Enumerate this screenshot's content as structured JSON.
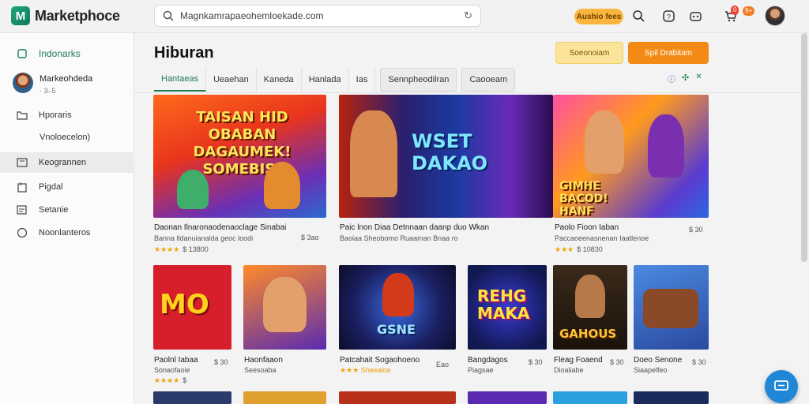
{
  "header": {
    "logo_text": "Marketphoce",
    "search_value": "Magnkamrapaeohemloekade.com",
    "promo_pill": "Aushio fees",
    "cart_badge": "0",
    "notif_badge": "9+"
  },
  "sidebar": {
    "items": [
      {
        "label": "Indonarks",
        "icon": "bookmark-icon"
      },
      {
        "label": "Hporaris",
        "icon": "folder-icon"
      },
      {
        "label": "Vnoloecelon)",
        "icon": ""
      },
      {
        "label": "Keogrannen",
        "icon": "image-icon"
      },
      {
        "label": "Pigdal",
        "icon": "tag-icon"
      },
      {
        "label": "Setanie",
        "icon": "list-icon"
      },
      {
        "label": "Noonlanteros",
        "icon": "help-icon"
      }
    ],
    "profile": {
      "name": "Markeohdeda",
      "sub": "· 3 ̶ 5"
    }
  },
  "main": {
    "title": "Hiburan",
    "btn_secondary": "Soeonoiam",
    "btn_primary": "Spil Drabitam",
    "tabs": [
      {
        "label": "Hantaeas",
        "active": true
      },
      {
        "label": "Ueaehan"
      },
      {
        "label": "Kaneda"
      },
      {
        "label": "Hanlada"
      },
      {
        "label": "Ias"
      },
      {
        "label": "Sennpheodilran",
        "boxed": true
      },
      {
        "label": "Caooeam",
        "boxed": true
      }
    ]
  },
  "featured": [
    {
      "art": "TAISAN HID OBABAN DAGAUMEK! SOMEBIS!",
      "title": "Daonan Ilnaronaodenaoclage Sinabai",
      "sub": "Banna lldanuianalda geoc loodi",
      "price": "$ 3ao",
      "stars": "★★★★",
      "rating": "$ 13800"
    },
    {
      "art": "WSET DAKAO",
      "title": "Paic lnon Diaa Detnnaan daanp duo Wkan",
      "sub": "Baoiaa Sheobomo  Ruaaman Bnaa ro",
      "price": "",
      "stars": "",
      "rating": ""
    },
    {
      "art": "GIMHE BACOD! HANF",
      "title": "Paolo Fioon Iaban",
      "sub": "Paccaoeenasnenan Iaatlenoe",
      "price": "$ 30",
      "stars": "★★★",
      "rating": "$ 10830"
    }
  ],
  "grid": [
    {
      "art": "MO",
      "title": "Paolnl Iabaa",
      "sub": "Sonaofaoie",
      "price": "$ 30",
      "stars": "★★★★",
      "rating": "$"
    },
    {
      "art": "",
      "title": "Haonfaaon",
      "sub": "Seesoaba",
      "price": "",
      "stars": "",
      "rating": ""
    },
    {
      "art": "GSNE",
      "title": "Patcahait Sogaohoeno",
      "sub": "★★★  Sheealoe",
      "price": "Eao",
      "stars": "",
      "rating": ""
    },
    {
      "art": "REHG MAKA",
      "title": "Bangdagos",
      "sub": "Piagsae",
      "price": "$ 30",
      "stars": "",
      "rating": ""
    },
    {
      "art": "GAHOUS",
      "title": "Fleag Foaend",
      "sub": "Dioaliabe",
      "price": "$ 30",
      "stars": "",
      "rating": ""
    },
    {
      "art": "",
      "title": "Doeo Senone",
      "sub": "Siaapelfeo",
      "price": "$ 30",
      "stars": "",
      "rating": ""
    }
  ],
  "colors": {
    "accent_green": "#1d7c56",
    "primary_orange": "#f38a16",
    "secondary_yellow": "#fbe39a",
    "chat_blue": "#1f87d6"
  }
}
